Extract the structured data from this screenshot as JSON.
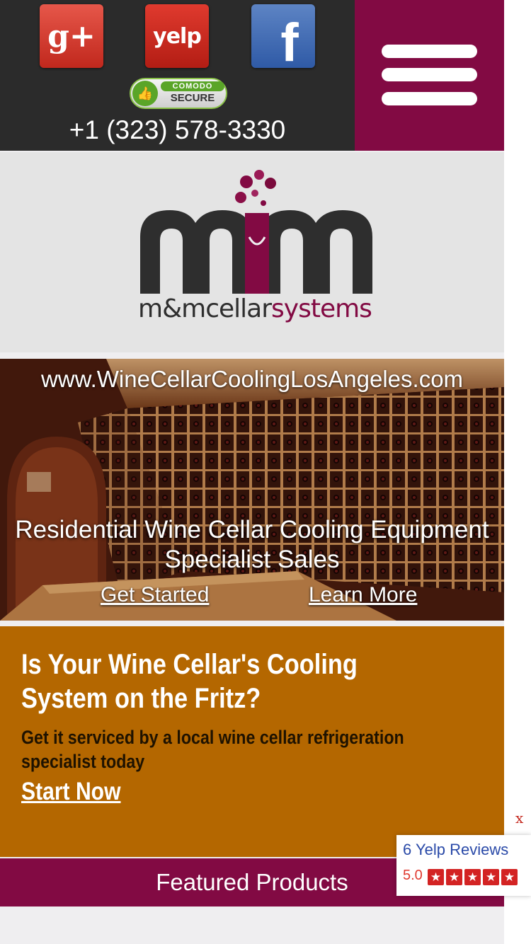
{
  "header": {
    "social": {
      "google_plus": "g+",
      "yelp": "yelp",
      "facebook": "f"
    },
    "badge": {
      "brand": "COMODO",
      "label": "SECURE"
    },
    "phone": "+1 (323) 578-3330",
    "menu_icon": "hamburger-menu-icon"
  },
  "logo": {
    "name_dark": "m&mcellar",
    "name_accent": "systems"
  },
  "hero": {
    "url": "www.WineCellarCoolingLosAngeles.com",
    "headline": "Residential Wine Cellar Cooling Equipment Specialist Sales",
    "cta_primary": "Get Started",
    "cta_secondary": "Learn More"
  },
  "promo": {
    "heading": "Is Your Wine Cellar's Cooling System on the Fritz?",
    "subheading": "Get it serviced by a local wine cellar refrigeration specialist today",
    "cta": "Start Now"
  },
  "featured": {
    "title": "Featured Products"
  },
  "yelp_widget": {
    "close_label": "x",
    "reviews": "6 Yelp Reviews",
    "rating": "5.0",
    "stars": 5
  },
  "colors": {
    "header_dark": "#2b2b2b",
    "brand_burgundy": "#820a43",
    "promo_orange": "#b46700"
  }
}
